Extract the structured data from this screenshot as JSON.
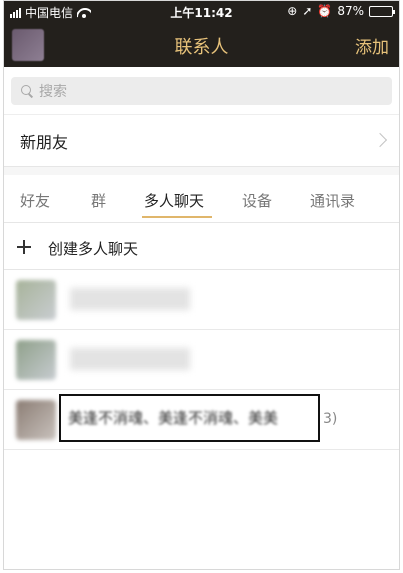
{
  "status": {
    "carrier": "中国电信",
    "time": "上午11:42",
    "battery": "87%",
    "battery_level": 0.87
  },
  "nav": {
    "title": "联系人",
    "add_label": "添加"
  },
  "search": {
    "placeholder": "搜索"
  },
  "new_friends": {
    "label": "新朋友"
  },
  "tabs": [
    {
      "label": "好友",
      "active": false
    },
    {
      "label": "群",
      "active": false
    },
    {
      "label": "多人聊天",
      "active": true
    },
    {
      "label": "设备",
      "active": false
    },
    {
      "label": "通讯录",
      "active": false
    }
  ],
  "create_group": {
    "label": "创建多人聊天"
  },
  "groups": [
    {
      "name": "",
      "avatar_colors": [
        "#a7b39a",
        "#c9cdd1"
      ]
    },
    {
      "name": "",
      "avatar_colors": [
        "#8fa08a",
        "#c7ccd0"
      ]
    },
    {
      "name": "美逢不消魂、美逢不消魂、美美",
      "count": "3)",
      "avatar_colors": [
        "#8b7d74",
        "#c9c2bd"
      ]
    }
  ],
  "colors": {
    "header_bg": "#23201c",
    "accent": "#e7c27a",
    "tab_underline": "#e0b66b"
  }
}
